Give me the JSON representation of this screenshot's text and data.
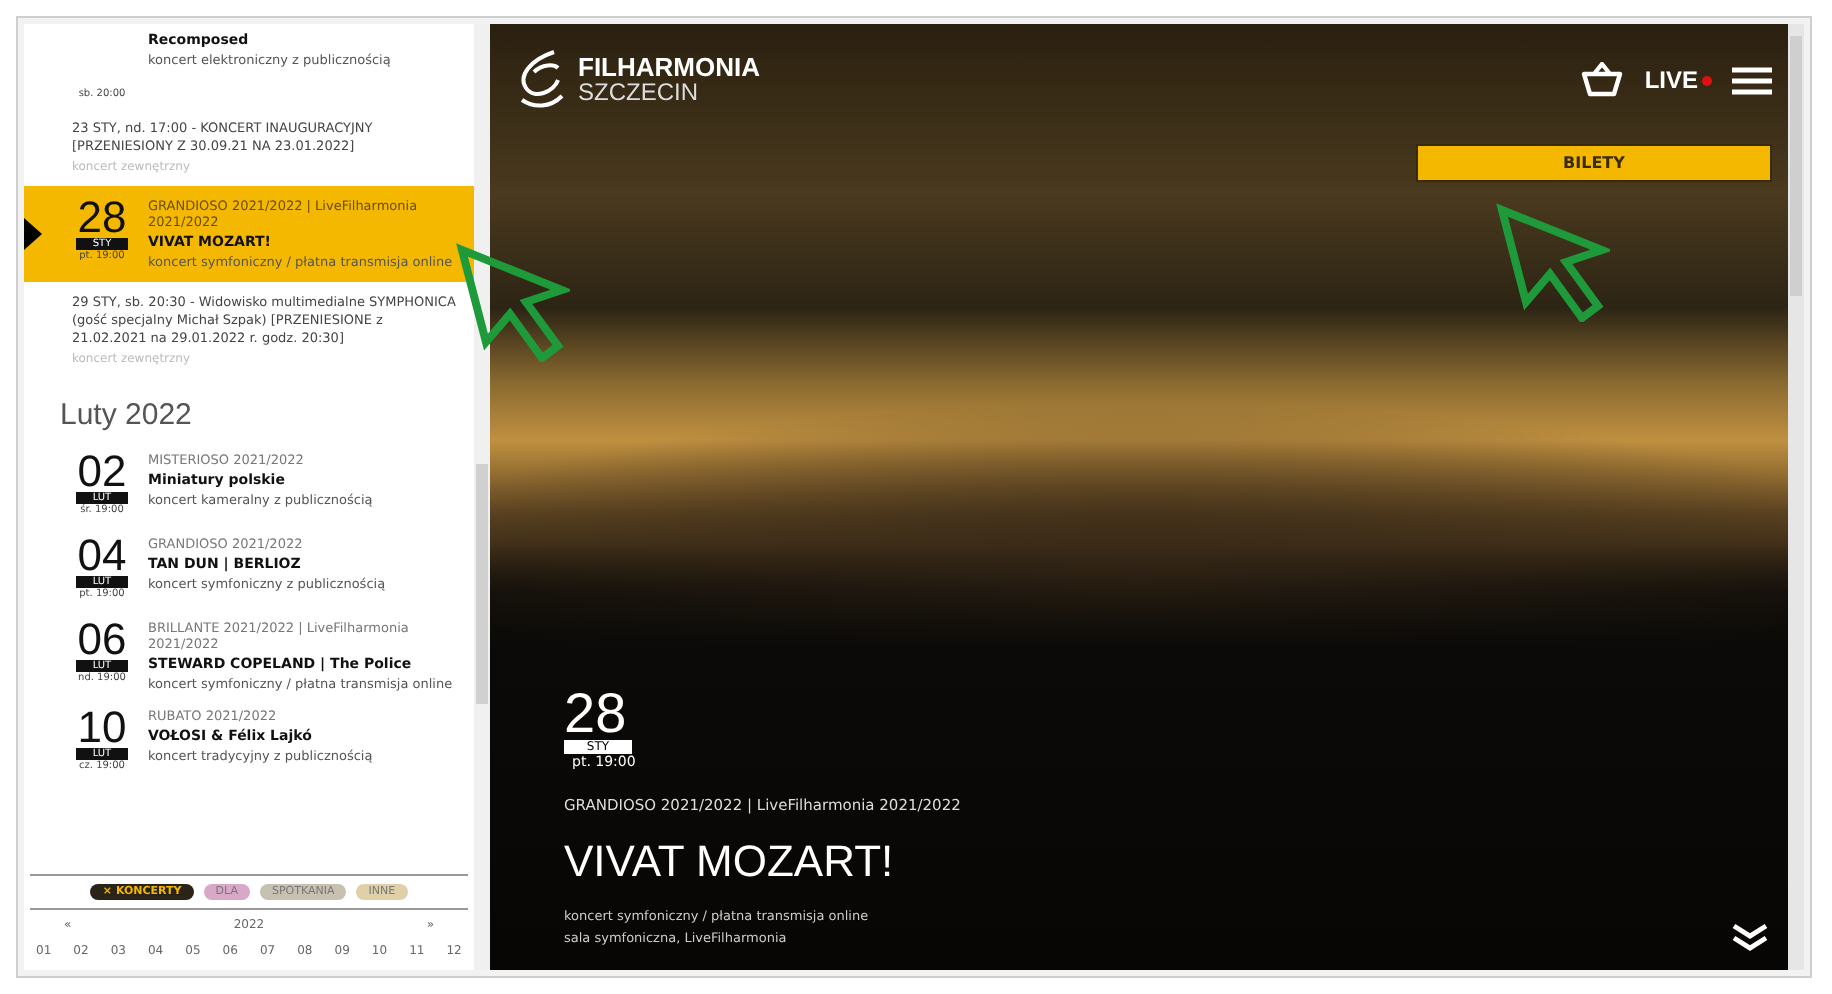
{
  "sidebar": {
    "items": [
      {
        "kind": "event",
        "selected": false,
        "time": "sb. 20:00",
        "title": "Recomposed",
        "type": "koncert elektroniczny z publicznością"
      },
      {
        "kind": "note",
        "text": "23 STY, nd. 17:00 - KONCERT INAUGURACYJNY [PRZENIESIONY Z 30.09.21 NA 23.01.2022]",
        "sub": "koncert zewnętrzny"
      },
      {
        "kind": "event",
        "selected": true,
        "day": "28",
        "month": "STY",
        "time": "pt. 19:00",
        "series": "GRANDIOSO 2021/2022 | LiveFilharmonia 2021/2022",
        "title": "VIVAT MOZART!",
        "type": "koncert symfoniczny / płatna transmisja online"
      },
      {
        "kind": "note",
        "text": "29 STY, sb. 20:30 - Widowisko multimedialne SYMPHONICA (gość specjalny Michał Szpak) [PRZENIESIONE z 21.02.2021 na 29.01.2022 r. godz. 20:30]",
        "sub": "koncert zewnętrzny"
      },
      {
        "kind": "month",
        "text": "Luty 2022"
      },
      {
        "kind": "event",
        "selected": false,
        "day": "02",
        "month": "LUT",
        "time": "śr. 19:00",
        "series": "MISTERIOSO 2021/2022",
        "title": "Miniatury polskie",
        "type": "koncert kameralny z publicznością"
      },
      {
        "kind": "event",
        "selected": false,
        "day": "04",
        "month": "LUT",
        "time": "pt. 19:00",
        "series": "GRANDIOSO 2021/2022",
        "title": "TAN DUN | BERLIOZ",
        "type": "koncert symfoniczny z publicznością"
      },
      {
        "kind": "event",
        "selected": false,
        "day": "06",
        "month": "LUT",
        "time": "nd. 19:00",
        "series": "BRILLANTE 2021/2022 | LiveFilharmonia 2021/2022",
        "title": "STEWARD COPELAND | The Police",
        "type": "koncert symfoniczny / płatna transmisja online"
      },
      {
        "kind": "event",
        "selected": false,
        "day": "10",
        "month": "LUT",
        "time": "cz. 19:00",
        "series": "RUBATO 2021/2022",
        "title": "VOŁOSI & Félix Lajkó",
        "type": "koncert tradycyjny z publicznością"
      }
    ],
    "filters": [
      {
        "label": "× KONCERTY",
        "selected": true,
        "color": "#2a2418"
      },
      {
        "label": "DLA",
        "selected": false,
        "color": "#d9a8c8"
      },
      {
        "label": "SPOTKANIA",
        "selected": false,
        "color": "#c8c0b0"
      },
      {
        "label": "INNE",
        "selected": false,
        "color": "#e0d0a8"
      }
    ],
    "year_nav": {
      "prev": "«",
      "year": "2022",
      "next": "»"
    },
    "months": [
      "01",
      "02",
      "03",
      "04",
      "05",
      "06",
      "07",
      "08",
      "09",
      "10",
      "11",
      "12"
    ]
  },
  "hero": {
    "logo": {
      "name": "FILHARMONIA",
      "city": "SZCZECIN"
    },
    "live": "LIVE",
    "tickets": "BILETY",
    "day": "28",
    "month": "STY",
    "time": "pt. 19:00",
    "series": "GRANDIOSO 2021/2022 | LiveFilharmonia 2021/2022",
    "title": "VIVAT MOZART!",
    "lines": [
      "koncert symfoniczny / płatna transmisja online",
      "sala symfoniczna, LiveFilharmonia"
    ]
  }
}
